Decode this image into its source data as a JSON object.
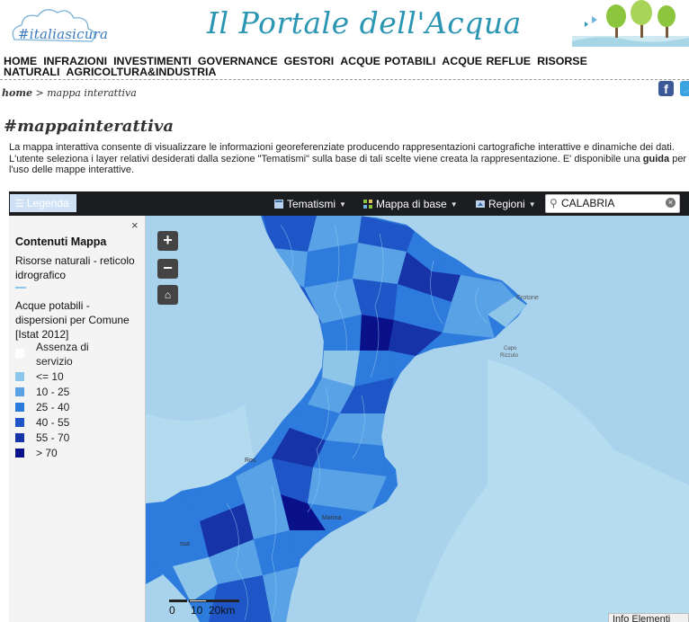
{
  "header": {
    "logo_text": "#italiasicura",
    "site_title": "Il Portale dell'Acqua"
  },
  "nav": {
    "items": [
      "HOME",
      "INFRAZIONI",
      "INVESTIMENTI",
      "GOVERNANCE",
      "GESTORI",
      "ACQUE POTABILI",
      "ACQUE REFLUE",
      "RISORSE NATURALI",
      "AGRICOLTURA&INDUSTRIA"
    ]
  },
  "breadcrumb": {
    "home": "home",
    "separator": ">",
    "current": "mappa interattiva"
  },
  "social": {
    "facebook": "f"
  },
  "page": {
    "heading": "#mappainterattiva",
    "intro_1": "La mappa interattiva consente di visualizzare le informazioni georeferenziate producendo rappresentazioni cartografiche interattive e dinamiche dei dati. L'utente seleziona i layer relativi desiderati dalla sezione \"Tematismi\" sulla base di tali scelte viene creata la rappresentazione. E' disponibile una ",
    "intro_bold": "guida",
    "intro_2": " per l'uso delle mappe interattive."
  },
  "toolbar": {
    "legend_label": "Legenda",
    "tematismi_label": "Tematismi",
    "mappa_label": "Mappa di base",
    "regioni_label": "Regioni",
    "search_value": "CALABRIA"
  },
  "legend": {
    "close": "×",
    "title": "Contenuti Mappa",
    "layer1": "Risorse naturali - reticolo idrografico",
    "layer2": "Acque potabili - dispersioni per Comune [Istat 2012]",
    "classes": [
      {
        "label": "Assenza di servizio",
        "color": "#ffffff"
      },
      {
        "label": "<= 10",
        "color": "#8ec6ea"
      },
      {
        "label": "10 - 25",
        "color": "#5aa2e6"
      },
      {
        "label": "25 - 40",
        "color": "#2d7bdc"
      },
      {
        "label": "40 - 55",
        "color": "#1e55c7"
      },
      {
        "label": "55 - 70",
        "color": "#1733a8"
      },
      {
        "label": "> 70",
        "color": "#0a0f8a"
      }
    ]
  },
  "map": {
    "labels": {
      "crotone": "Crotone",
      "capo": "Capo",
      "rizzuto": "Rizzuto",
      "rosarno": "Ros",
      "marina": "Marina",
      "messina": "ssa"
    },
    "zoom_in": "+",
    "zoom_out": "−",
    "scale": {
      "zero": "0",
      "ten": "10",
      "twenty": "20km"
    },
    "info_tab": "Info Elementi"
  }
}
